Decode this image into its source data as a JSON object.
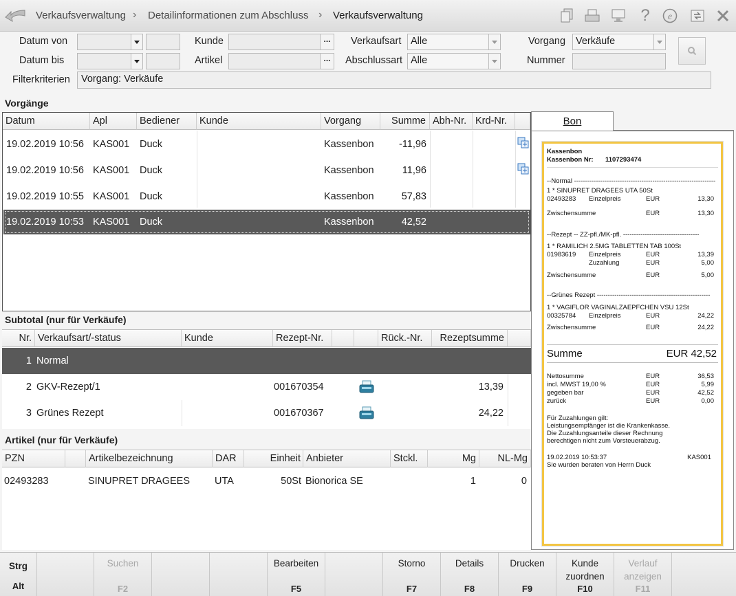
{
  "breadcrumb": [
    "Verkaufsverwaltung",
    "Detailinformationen zum Abschluss",
    "Verkaufsverwaltung"
  ],
  "filters": {
    "datum_von_label": "Datum von",
    "datum_bis_label": "Datum bis",
    "kunde_label": "Kunde",
    "artikel_label": "Artikel",
    "verkaufsart_label": "Verkaufsart",
    "verkaufsart_value": "Alle",
    "abschlussart_label": "Abschlussart",
    "abschlussart_value": "Alle",
    "vorgang_label": "Vorgang",
    "vorgang_value": "Verkäufe",
    "nummer_label": "Nummer",
    "filterkriterien_label": "Filterkriterien",
    "filterkriterien_value": "Vorgang: Verkäufe"
  },
  "vorgaenge": {
    "title": "Vorgänge",
    "columns": [
      "Datum",
      "Apl",
      "Bediener",
      "Kunde",
      "Vorgang",
      "Summe",
      "Abh-Nr.",
      "Krd-Nr."
    ],
    "rows": [
      {
        "datum": "19.02.2019 10:56",
        "apl": "KAS001",
        "bediener": "Duck",
        "kunde": "",
        "vorgang": "Kassenbon",
        "summe": "-11,96",
        "icon": "copy-icon"
      },
      {
        "datum": "19.02.2019 10:56",
        "apl": "KAS001",
        "bediener": "Duck",
        "kunde": "",
        "vorgang": "Kassenbon",
        "summe": "11,96",
        "icon": "copy-icon"
      },
      {
        "datum": "19.02.2019 10:55",
        "apl": "KAS001",
        "bediener": "Duck",
        "kunde": "",
        "vorgang": "Kassenbon",
        "summe": "57,83",
        "icon": ""
      },
      {
        "datum": "19.02.2019 10:53",
        "apl": "KAS001",
        "bediener": "Duck",
        "kunde": "",
        "vorgang": "Kassenbon",
        "summe": "42,52",
        "icon": "",
        "selected": true
      }
    ]
  },
  "subtotal": {
    "title": "Subtotal (nur für Verkäufe)",
    "columns": [
      "Nr.",
      "Verkaufsart/-status",
      "Kunde",
      "Rezept-Nr.",
      "",
      "Rück.-Nr.",
      "Rezeptsumme"
    ],
    "rows": [
      {
        "nr": "1",
        "art": "Normal",
        "kunde": "",
        "rezept_nr": "",
        "icon": "",
        "rueck": "",
        "summe": "",
        "selected": true
      },
      {
        "nr": "2",
        "art": "GKV-Rezept/1",
        "kunde": "",
        "rezept_nr": "001670354",
        "icon": "scanner-icon",
        "rueck": "",
        "summe": "13,39"
      },
      {
        "nr": "3",
        "art": "Grünes Rezept",
        "kunde": "",
        "rezept_nr": "001670367",
        "icon": "scanner-icon",
        "rueck": "",
        "summe": "24,22"
      }
    ]
  },
  "artikel": {
    "title": "Artikel (nur für Verkäufe)",
    "columns": [
      "PZN",
      "",
      "Artikelbezeichnung",
      "DAR",
      "Einheit",
      "Anbieter",
      "Stckl.",
      "Mg",
      "NL-Mg"
    ],
    "rows": [
      {
        "pzn": "02493283",
        "bez": "SINUPRET DRAGEES",
        "dar": "UTA",
        "einheit": "50St",
        "anbieter": "Bionorica SE",
        "stckl": "",
        "mg": "1",
        "nlmg": "0"
      }
    ]
  },
  "bon": {
    "tab_label": "Bon",
    "lines": {
      "h1": "Kassenbon",
      "h2a": "Kassenbon Nr:",
      "h2b": "1107293474",
      "s_normal": "--Normal -----------------------------------------------------------------",
      "n1": "1 * SINUPRET DRAGEES UTA 50St",
      "n2a": "02493283",
      "n2b": "Einzelpreis",
      "n2c": "EUR",
      "n2d": "13,30",
      "n3a": "Zwischensumme",
      "n3c": "EUR",
      "n3d": "13,30",
      "s_rezept": "--Rezept -- ZZ-pfl./MK-pfl. -----------------------------------",
      "r1": "1 * RAMILICH 2.5MG TABLETTEN TAB 100St",
      "r2a": "01983619",
      "r2b": "Einzelpreis",
      "r2c": "EUR",
      "r2d": "13,39",
      "r3b": "Zuzahlung",
      "r3c": "EUR",
      "r3d": "5,00",
      "r4a": "Zwischensumme",
      "r4c": "EUR",
      "r4d": "5,00",
      "s_gruen": "--Grünes Rezept ----------------------------------------------------",
      "g1": "1 * VAGIFLOR VAGINALZAEPFCHEN VSU 12St",
      "g2a": "00325784",
      "g2b": "Einzelpreis",
      "g2c": "EUR",
      "g2d": "24,22",
      "g3a": "Zwischensumme",
      "g3c": "EUR",
      "g3d": "24,22",
      "sum_label": "Summe",
      "sum_value": "EUR 42,52",
      "t1a": "Nettosumme",
      "t1c": "EUR",
      "t1d": "36,53",
      "t2a": "incl. MWST 19,00 %",
      "t2c": "EUR",
      "t2d": "5,99",
      "t3a": "gegeben bar",
      "t3c": "EUR",
      "t3d": "42,52",
      "t4a": "zurück",
      "t4c": "EUR",
      "t4d": "0,00",
      "z1": "Für Zuzahlungen gilt:",
      "z2": "Leistungsempfänger ist die Krankenkasse.",
      "z3": "Die Zuzahlungsanteile dieser Rechnung",
      "z4": "berechtigen nicht zum Vorsteuerabzug.",
      "f1": "19.02.2019 10:53:37",
      "f1b": "KAS001",
      "f2": "Sie wurden beraten von Herrn Duck"
    }
  },
  "fkeys": {
    "strg": "Strg",
    "alt": "Alt",
    "suchen": "Suchen",
    "f2": "F2",
    "bearbeiten": "Bearbeiten",
    "f5": "F5",
    "storno": "Storno",
    "f7": "F7",
    "details": "Details",
    "f8": "F8",
    "drucken": "Drucken",
    "f9": "F9",
    "kunde1": "Kunde",
    "kunde2": "zuordnen",
    "f10": "F10",
    "verlauf1": "Verlauf",
    "verlauf2": "anzeigen",
    "f11": "F11"
  }
}
